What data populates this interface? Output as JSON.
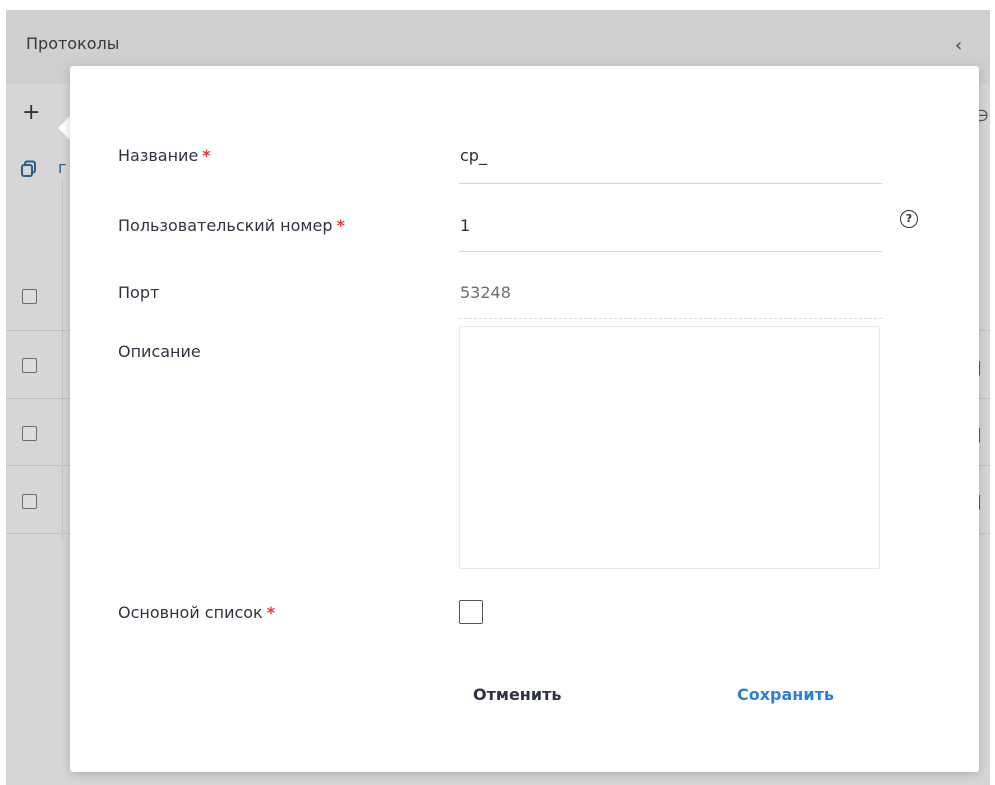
{
  "background": {
    "title": "Протоколы",
    "collapse_icon": "chevron-left-icon",
    "add_icon": "plus-icon",
    "copy_icon": "copy-icon",
    "copy_text": "г",
    "right_icon_glyph": "∋",
    "trail_glyph": "]"
  },
  "form": {
    "name": {
      "label": "Название",
      "value": "cp_",
      "required": "*"
    },
    "user_number": {
      "label": "Пользовательский номер",
      "value": "1",
      "required": "*",
      "help": "?"
    },
    "port": {
      "label": "Порт",
      "value": "53248"
    },
    "description": {
      "label": "Описание",
      "value": ""
    },
    "main_list": {
      "label": "Основной список",
      "required": "*",
      "checked": false
    }
  },
  "actions": {
    "cancel_label": "Отменить",
    "save_label": "Сохранить"
  },
  "colors": {
    "accent": "#2f7fd6",
    "required": "#e03b3b",
    "overlay": "#d6d6d6"
  }
}
